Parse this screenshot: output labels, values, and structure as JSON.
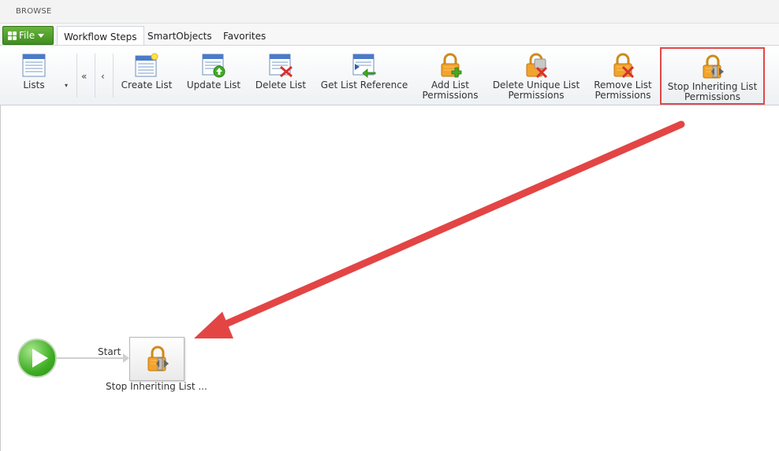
{
  "topbar": {
    "browse_label": "BROWSE"
  },
  "tabs": {
    "file_label": "File",
    "items": [
      {
        "label": "Workflow Steps"
      },
      {
        "label": "SmartObjects"
      },
      {
        "label": "Favorites"
      }
    ]
  },
  "ribbon": {
    "lists_label": "Lists",
    "buttons": [
      {
        "label": "Create List"
      },
      {
        "label": "Update List"
      },
      {
        "label": "Delete List"
      },
      {
        "label": "Get List Reference"
      },
      {
        "label": "Add List Permissions"
      },
      {
        "label": "Delete Unique List Permissions"
      },
      {
        "label": "Remove List Permissions"
      },
      {
        "label": "Stop Inheriting List Permissions"
      }
    ]
  },
  "canvas": {
    "start_label": "Start",
    "step_label": "Stop Inheriting List ..."
  },
  "colors": {
    "highlight": "#e04848",
    "file_green": "#4a9a2a",
    "annotation_arrow": "#e34545"
  }
}
